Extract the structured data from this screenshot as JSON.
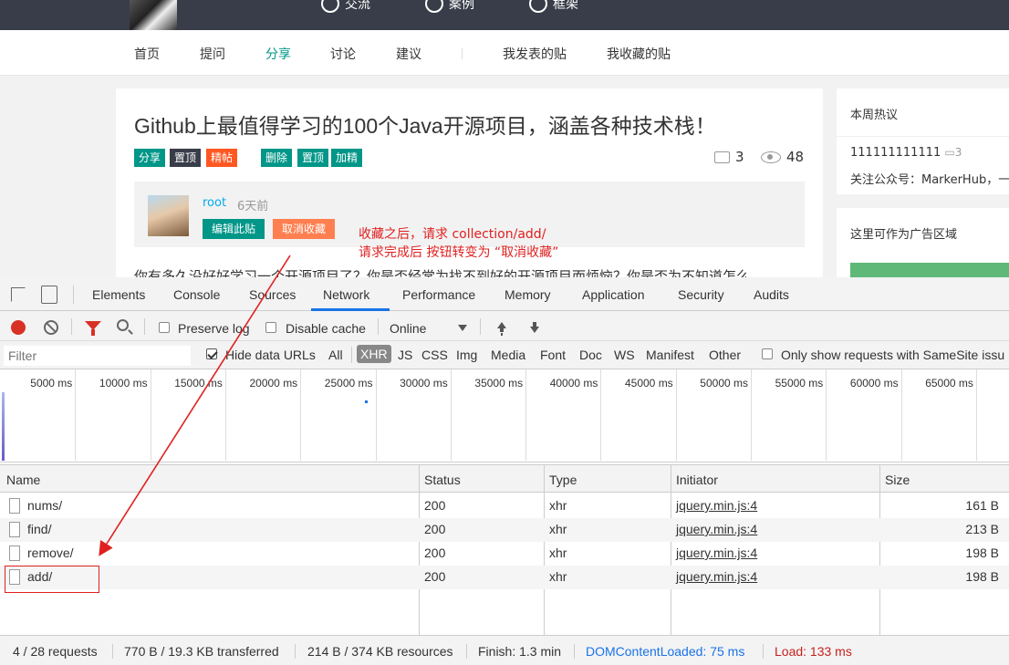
{
  "topbar": {
    "nav": [
      {
        "label": "交流",
        "icon": "headset-icon"
      },
      {
        "label": "案例",
        "icon": "crown-icon"
      },
      {
        "label": "框架",
        "icon": "layers-icon"
      }
    ]
  },
  "subnav": {
    "items": [
      "首页",
      "提问",
      "分享",
      "讨论",
      "建议"
    ],
    "active": "分享",
    "right_items": [
      "我发表的贴",
      "我收藏的贴"
    ]
  },
  "post": {
    "title": "Github上最值得学习的100个Java开源项目，涵盖各种技术栈！",
    "tags": [
      {
        "label": "分享",
        "color": "#009688"
      },
      {
        "label": "置顶",
        "color": "#393d49"
      },
      {
        "label": "精帖",
        "color": "#ff5722"
      },
      {
        "label": "删除",
        "color": "#009688"
      },
      {
        "label": "置顶",
        "color": "#009688"
      },
      {
        "label": "加精",
        "color": "#009688"
      }
    ],
    "comments": "3",
    "views": "48",
    "author": {
      "name": "root",
      "time": "6天前"
    },
    "author_buttons": [
      {
        "label": "编辑此贴",
        "color": "#009688"
      },
      {
        "label": "取消收藏",
        "color": "#ff7f50"
      }
    ],
    "body_preview": "你有多久没好好学习一个开源项目了？你是否经常为找不到好的开源项目而烦恼？你是否为不知道怎么"
  },
  "sidebar": {
    "hot_title": "本周热议",
    "hot_item": "111111111111",
    "hot_item_count": "3",
    "hot_item2": "关注公众号：MarkerHub，一",
    "ad_title": "这里可作为广告区域"
  },
  "annotation": {
    "line1": "收藏之后，请求 collection/add/",
    "line2": "请求完成后 按钮转变为 “取消收藏”",
    "color": "#e02020"
  },
  "devtools": {
    "tabs": [
      "Elements",
      "Console",
      "Sources",
      "Network",
      "Performance",
      "Memory",
      "Application",
      "Security",
      "Audits"
    ],
    "active_tab": "Network",
    "toolbar": {
      "preserve_log": "Preserve log",
      "disable_cache": "Disable cache",
      "throttle": "Online"
    },
    "filter": {
      "placeholder": "Filter",
      "hide_data_urls": "Hide data URLs",
      "types": [
        "All",
        "XHR",
        "JS",
        "CSS",
        "Img",
        "Media",
        "Font",
        "Doc",
        "WS",
        "Manifest",
        "Other"
      ],
      "active_type": "XHR",
      "samesite": "Only show requests with SameSite issu"
    },
    "overview_ticks": [
      "5000 ms",
      "10000 ms",
      "15000 ms",
      "20000 ms",
      "25000 ms",
      "30000 ms",
      "35000 ms",
      "40000 ms",
      "45000 ms",
      "50000 ms",
      "55000 ms",
      "60000 ms",
      "65000 ms",
      "70"
    ],
    "columns": [
      "Name",
      "Status",
      "Type",
      "Initiator",
      "Size"
    ],
    "rows": [
      {
        "name": "nums/",
        "status": "200",
        "type": "xhr",
        "initiator": "jquery.min.js:4",
        "size": "161 B"
      },
      {
        "name": "find/",
        "status": "200",
        "type": "xhr",
        "initiator": "jquery.min.js:4",
        "size": "213 B"
      },
      {
        "name": "remove/",
        "status": "200",
        "type": "xhr",
        "initiator": "jquery.min.js:4",
        "size": "198 B"
      },
      {
        "name": "add/",
        "status": "200",
        "type": "xhr",
        "initiator": "jquery.min.js:4",
        "size": "198 B"
      }
    ],
    "status_bar": {
      "requests": "4 / 28 requests",
      "transferred": "770 B / 19.3 KB transferred",
      "resources": "214 B / 374 KB resources",
      "finish": "Finish: 1.3 min",
      "dom": "DOMContentLoaded: 75 ms",
      "load": "Load: 133 ms",
      "dom_color": "#1a73e8",
      "load_color": "#c5221f"
    }
  }
}
